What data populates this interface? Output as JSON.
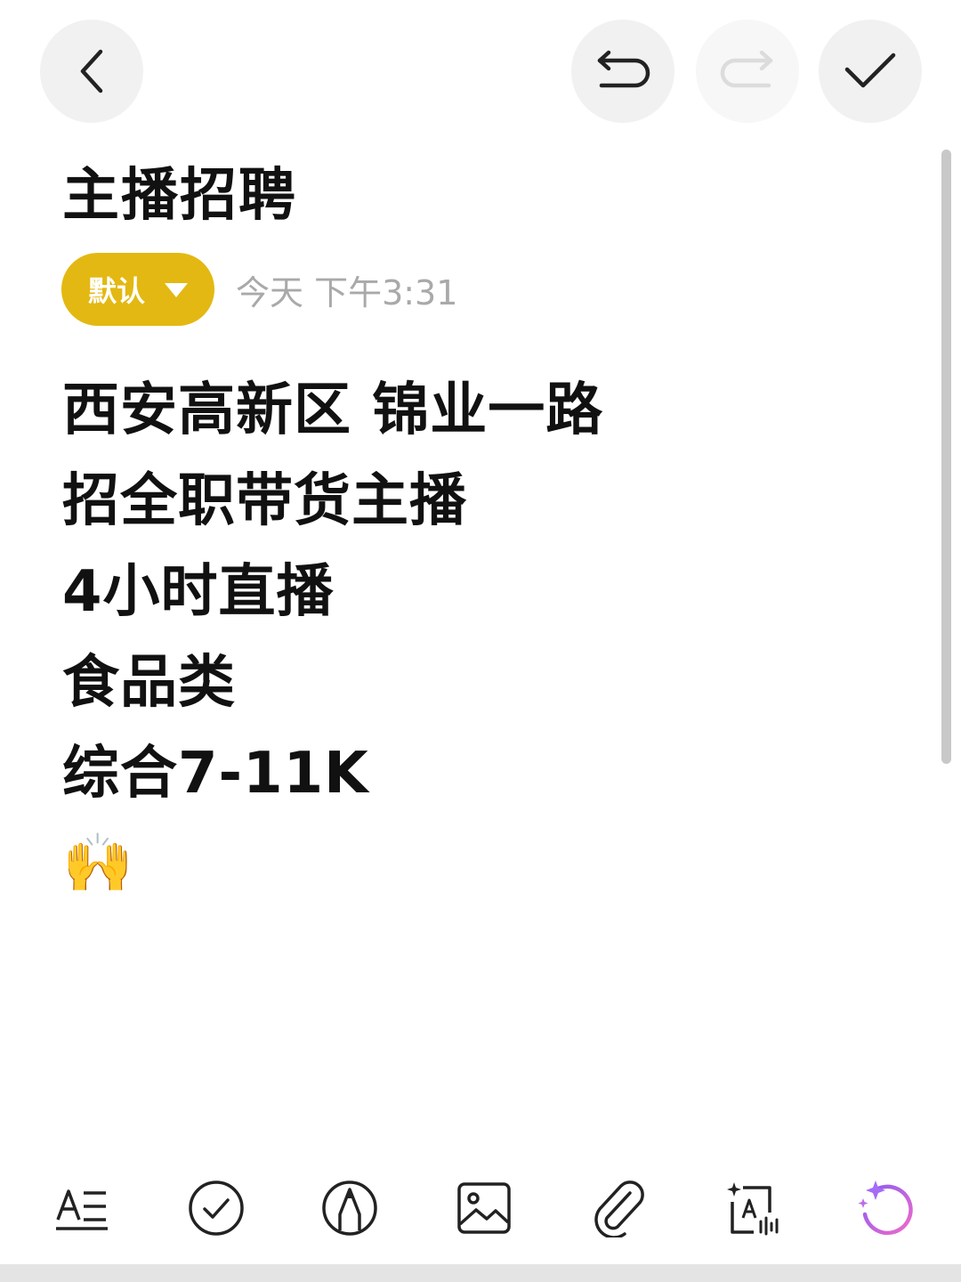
{
  "header": {
    "back_icon": "chevron-left-icon",
    "undo_icon": "undo-icon",
    "redo_icon": "redo-icon",
    "done_icon": "checkmark-icon",
    "redo_enabled": false
  },
  "note": {
    "title": "主播招聘",
    "folder_label": "默认",
    "timestamp": "今天 下午3:31",
    "lines": [
      "西安高新区 锦业一路",
      "招全职带货主播",
      "4小时直播",
      "食品类",
      "综合7-11K"
    ],
    "emoji": "🙌"
  },
  "toolbar": {
    "items": [
      "text-format-icon",
      "checklist-icon",
      "pen-icon",
      "image-icon",
      "attachment-icon",
      "ai-voice-text-icon",
      "ai-assistant-icon"
    ]
  },
  "colors": {
    "folder_pill": "#e3b812",
    "timestamp": "#a9a9a9",
    "button_bg": "#f1f1f1",
    "ai_gradient_start": "#8a5cf6",
    "ai_gradient_end": "#f06ac8"
  }
}
